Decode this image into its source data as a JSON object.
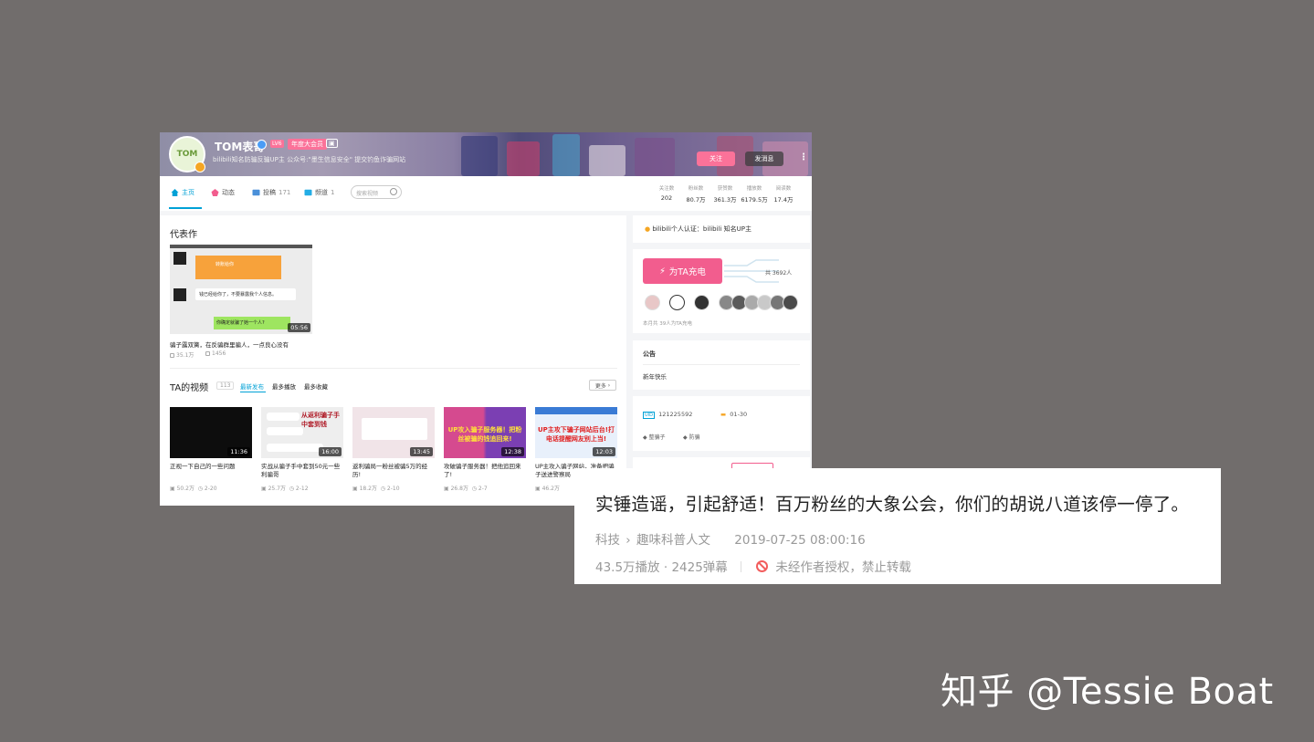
{
  "profile": {
    "name": "TOM表哥",
    "level_badge": "LV6",
    "vip_badge": "年度大会员",
    "extra_badge": "",
    "signature": "bilibili知名防骗反骗UP主 公众号:\"墨生信息安全\" 提交钓鱼诈骗网站",
    "follow_label": "关注",
    "message_label": "发消息"
  },
  "nav": {
    "items": [
      {
        "label": "主页",
        "count": ""
      },
      {
        "label": "动态",
        "count": ""
      },
      {
        "label": "投稿",
        "count": "171"
      },
      {
        "label": "频道",
        "count": "1"
      }
    ],
    "search_placeholder": "搜索视频"
  },
  "stats": [
    {
      "key": "关注数",
      "value": "202"
    },
    {
      "key": "粉丝数",
      "value": "80.7万"
    },
    {
      "key": "获赞数",
      "value": "361.3万"
    },
    {
      "key": "播放数",
      "value": "6179.5万"
    },
    {
      "key": "阅读数",
      "value": "17.4万"
    }
  ],
  "representative": {
    "heading": "代表作",
    "thumb_card_title": "转账给你",
    "chat_1": "钱已经给你了，不要暴露我个人信息。",
    "chat_2": "你确定就骗了她一个人?",
    "duration": "05:56",
    "title": "骗子露双簧，在反骗群里骗人，一点良心没有",
    "views": "35.1万",
    "danmaku": "1456"
  },
  "videos_section": {
    "heading": "TA的视频",
    "count": "113",
    "sort_tabs": [
      "最新发布",
      "最多播放",
      "最多收藏"
    ],
    "more_label": "更多"
  },
  "videos": [
    {
      "title": "正视一下自己的一些问题",
      "duration": "11:36",
      "views": "50.2万",
      "date": "2-20",
      "overlay": ""
    },
    {
      "title": "实战从骗子手中套到50元一些利骗哥",
      "duration": "16:00",
      "views": "25.7万",
      "date": "2-12",
      "overlay": "从返利骗子手中套到钱"
    },
    {
      "title": "返利骗局一粉丝被骗5万的经历!",
      "duration": "13:45",
      "views": "18.2万",
      "date": "2-10",
      "overlay": ""
    },
    {
      "title": "攻破骗子服务器！把他追回来了!",
      "duration": "12:38",
      "views": "26.8万",
      "date": "2-7",
      "overlay": "UP攻入骗子服务器！把粉丝被骗的钱追回来!"
    },
    {
      "title": "UP主攻入骗子网站，准备把骗子送进警察局",
      "duration": "12:03",
      "views": "46.2万",
      "date": "",
      "overlay": "UP主攻下骗子网站后台!打电话提醒网友别上当!"
    }
  ],
  "sidebar": {
    "verify_text": "bilibili个人认证：bilibili 知名UP主",
    "charge_label": "为TA充电",
    "charge_total": "共 3692人",
    "charge_month": "本月共 39人为TA充电",
    "notice_heading": "公告",
    "notice_text": "新年快乐",
    "uid": "121225592",
    "birthday": "01-30",
    "tags": [
      "整骗子",
      "防骗"
    ]
  },
  "video_info": {
    "title": "实锤造谣，引起舒适！百万粉丝的大象公会，你们的胡说八道该停一停了。",
    "category": "科技",
    "subcategory": "趣味科普人文",
    "publish_time": "2019-07-25 08:00:16",
    "plays": "43.5万播放",
    "danmaku": "2425弹幕",
    "copyright": "未经作者授权，禁止转载"
  },
  "watermark": "知乎 @Tessie Boat",
  "colors": {
    "bilibili_pink": "#fb7299",
    "bilibili_blue": "#00a1d6",
    "background": "#716d6c",
    "ban_red": "#f25d5d"
  }
}
